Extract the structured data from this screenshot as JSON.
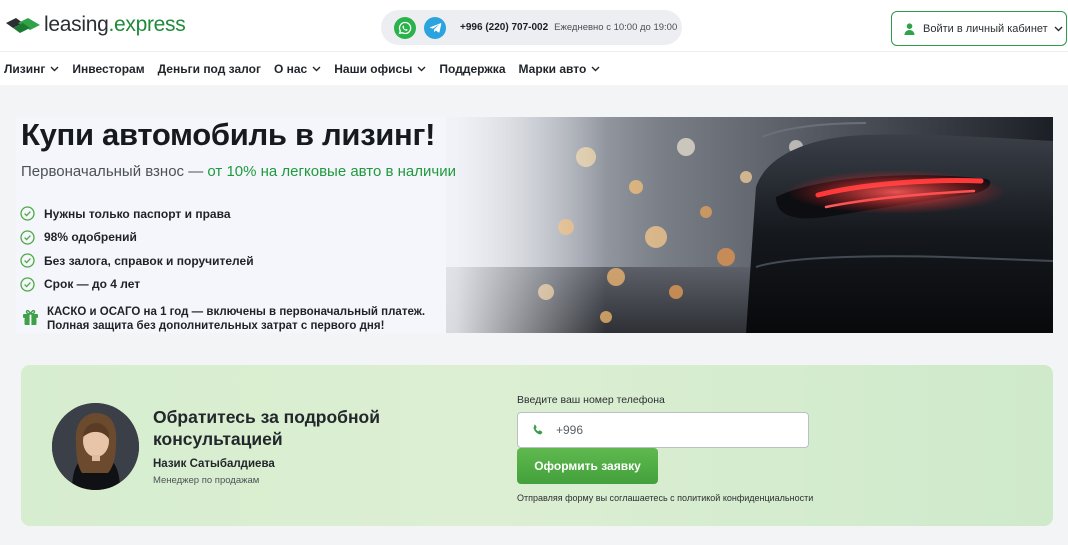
{
  "header": {
    "logo": {
      "part1": "leasing",
      "part2": ".express"
    },
    "contacts": {
      "phone_prefix": "+996 ",
      "phone_code": "(220)",
      "phone_number": " 707-002",
      "hours": "Ежедневно с 10:00 до 19:00",
      "icons": [
        "whatsapp-icon",
        "telegram-icon"
      ]
    },
    "login_label": "Войти в личный кабинет"
  },
  "nav": {
    "items": [
      {
        "label": "Лизинг",
        "dropdown": true
      },
      {
        "label": "Инвесторам",
        "dropdown": false
      },
      {
        "label": "Деньги под залог",
        "dropdown": false
      },
      {
        "label": "О нас",
        "dropdown": true
      },
      {
        "label": "Наши офисы",
        "dropdown": true
      },
      {
        "label": "Поддержка",
        "dropdown": false
      },
      {
        "label": "Марки авто",
        "dropdown": true
      }
    ]
  },
  "hero": {
    "title": "Купи автомобиль в лизинг!",
    "subtitle_prefix": "Первоначальный взнос — ",
    "subtitle_highlight": "от 10% на легковые авто в наличии",
    "features": [
      "Нужны только паспорт и права",
      "98% одобрений",
      "Без залога, справок и поручителей",
      "Срок — до 4 лет"
    ],
    "insurance_line1": "КАСКО и ОСАГО на 1 год — включены в первоначальный платеж.",
    "insurance_line2": "Полная защита без дополнительных затрат с первого дня!"
  },
  "consultation": {
    "title": "Обратитесь за подробной консультацией",
    "manager_name": "Назик Сатыбалдиева",
    "manager_role": "Менеджер по продажам",
    "phone_label": "Введите ваш номер телефона",
    "phone_placeholder": "+996",
    "submit_label": "Оформить заявку",
    "policy_text": "Отправляя форму вы соглашаетесь с политикой конфиденциальности"
  },
  "colors": {
    "brand_green": "#1f9a3e",
    "button_green": "#4caa42",
    "whatsapp": "#29b34a",
    "telegram": "#2aa3df",
    "card_bg": "#d7edcf"
  }
}
